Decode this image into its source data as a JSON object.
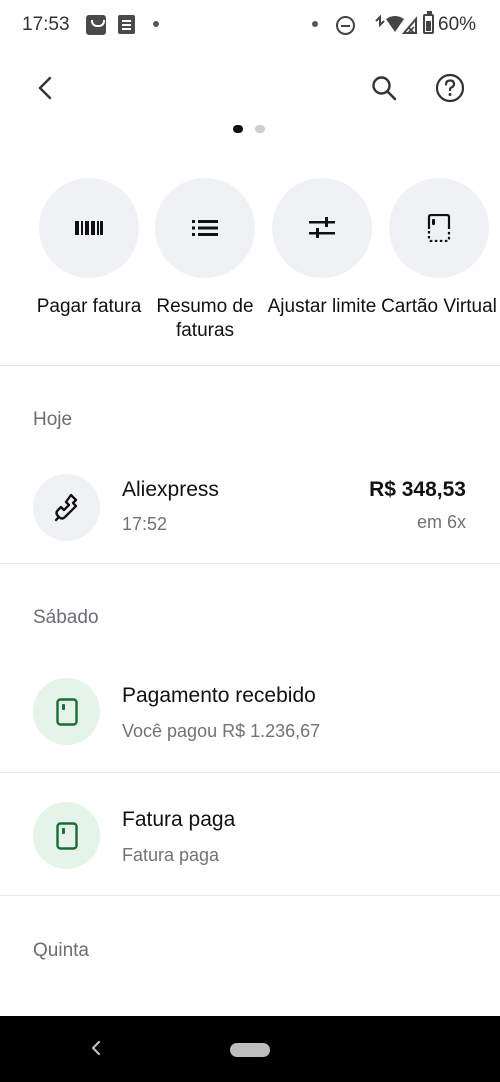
{
  "status_bar": {
    "time": "17:53",
    "battery": "60%"
  },
  "top_bar": {
    "back_icon": "chevron-left-icon",
    "search_icon": "search-icon",
    "help_icon": "help-circle-icon"
  },
  "page_indicator": {
    "total": 2,
    "active": 1
  },
  "actions": [
    {
      "label": "Pagar fatura",
      "icon": "barcode-icon"
    },
    {
      "label": "Resumo de faturas",
      "icon": "list-icon"
    },
    {
      "label": "Ajustar limite",
      "icon": "sliders-icon"
    },
    {
      "label": "Cartão Virtual",
      "icon": "virtual-card-icon"
    }
  ],
  "sections": [
    {
      "title": "Hoje",
      "items": [
        {
          "title": "Aliexpress",
          "subtitle": "17:52",
          "amount": "R$ 348,53",
          "installments": "em 6x",
          "icon": "wrench-icon"
        }
      ]
    },
    {
      "title": "Sábado",
      "items": [
        {
          "title": "Pagamento recebido",
          "subtitle": "Você pagou R$ 1.236,67",
          "icon": "card-icon"
        },
        {
          "title": "Fatura paga",
          "subtitle": "Fatura paga",
          "icon": "card-icon"
        }
      ]
    },
    {
      "title": "Quinta",
      "items": []
    }
  ],
  "colors": {
    "icon_bg_gray": "#f0f1f4",
    "icon_bg_green": "#e4f4e8",
    "icon_green": "#1b6b35",
    "muted_text": "#707276"
  }
}
